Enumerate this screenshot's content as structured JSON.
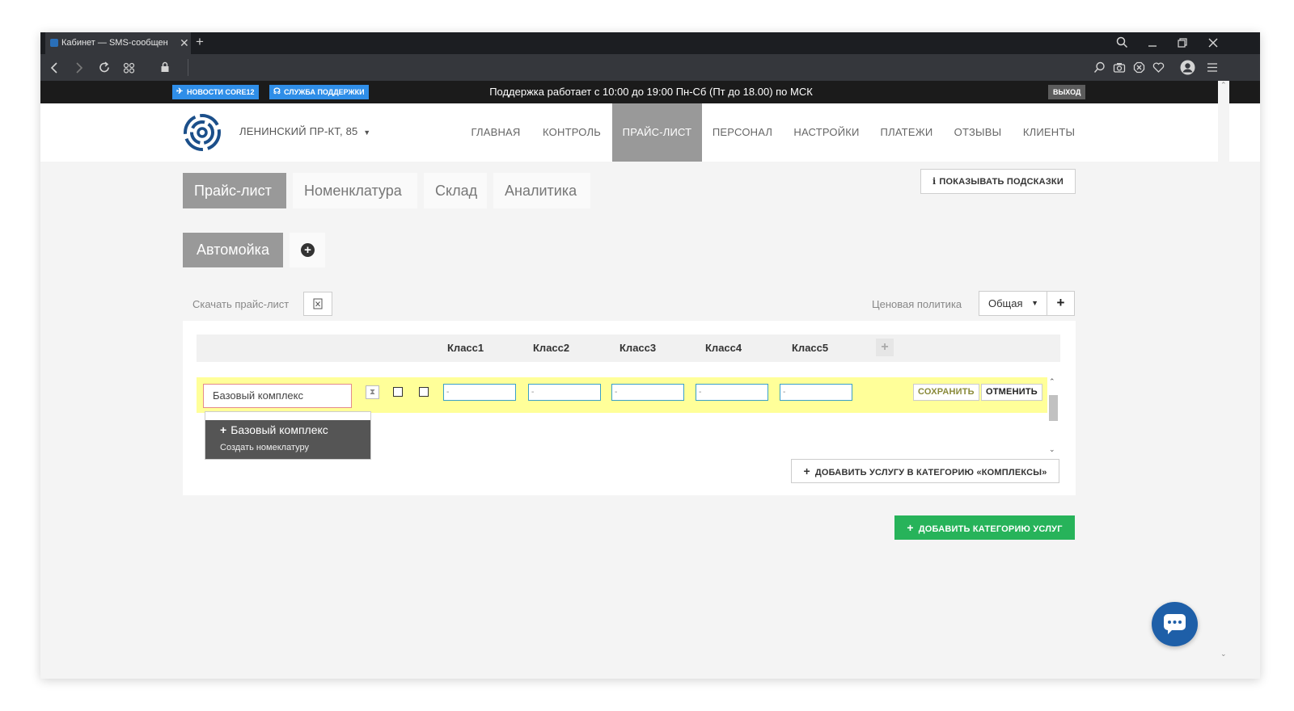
{
  "browser": {
    "tab_title": "Кабинет — SMS-сообщен",
    "tab_close": "✕",
    "new_tab": "+"
  },
  "topbar": {
    "news_label": "НОВОСТИ CORE12",
    "support_label": "СЛУЖБА ПОДДЕРЖКИ",
    "support_hours": "Поддержка работает с 10:00 до 19:00 Пн-Сб (Пт до 18.00) по МСК",
    "exit_label": "ВЫХОД"
  },
  "header": {
    "branch": "ЛЕНИНСКИЙ ПР-КТ, 85",
    "menu": [
      {
        "label": "ГЛАВНАЯ"
      },
      {
        "label": "КОНТРОЛЬ"
      },
      {
        "label": "ПРАЙС-ЛИСТ"
      },
      {
        "label": "ПЕРСОНАЛ"
      },
      {
        "label": "НАСТРОЙКИ"
      },
      {
        "label": "ПЛАТЕЖИ"
      },
      {
        "label": "ОТЗЫВЫ"
      },
      {
        "label": "КЛИЕНТЫ"
      }
    ],
    "active_menu": "ПРАЙС-ЛИСТ"
  },
  "subtabs": [
    {
      "label": "Прайс-лист"
    },
    {
      "label": "Номенклатура"
    },
    {
      "label": "Склад"
    },
    {
      "label": "Аналитика"
    }
  ],
  "hints_button": "ПОКАЗЫВАТЬ ПОДСКАЗКИ",
  "category": "Автомойка",
  "download_label": "Скачать прайс-лист",
  "price_policy": {
    "label": "Ценовая политика",
    "selected": "Общая"
  },
  "table": {
    "columns": [
      "Класс1",
      "Класс2",
      "Класс3",
      "Класс4",
      "Класс5"
    ],
    "edit_row": {
      "name_value": "Базовый комплекс",
      "price_values": [
        "-",
        "-",
        "-",
        "-",
        "-"
      ],
      "save_label": "СОХРАНИТЬ",
      "cancel_label": "ОТМЕНИТЬ"
    },
    "suggestion": {
      "title": "Базовый комплекс",
      "subtitle": "Создать номеклатуру"
    }
  },
  "add_service_label": "ДОБАВИТЬ УСЛУГУ В КАТЕГОРИЮ «КОМПЛЕКСЫ»",
  "add_category_label": "ДОБАВИТЬ КАТЕГОРИЮ УСЛУГ",
  "colors": {
    "accent_green": "#27b35a",
    "active_gray": "#999999",
    "edit_row_yellow": "#ffff99",
    "chat_blue": "#1e5fa8",
    "pill_blue": "#2f8ee8"
  }
}
